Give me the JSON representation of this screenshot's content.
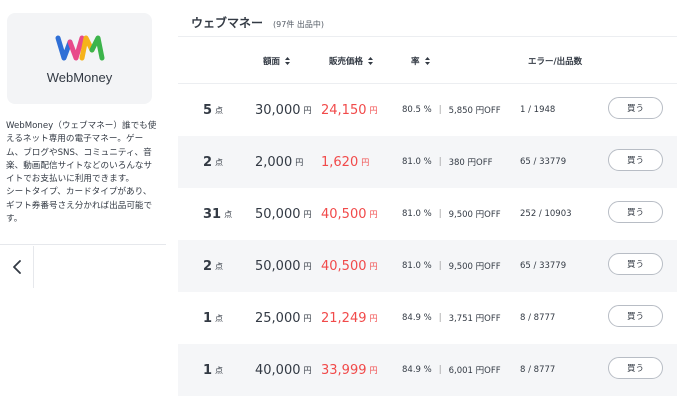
{
  "brand": {
    "logo_text": "WebMoney",
    "description": "WebMoney（ウェブマネー）誰でも使えるネット専用の電子マネー。ゲーム、ブログやSNS、コミュニティ、音楽、動画配信サイトなどのいろんなサイトでお支払いに利用できます。\nシートタイプ、カードタイプがあり、ギフト券番号さえ分かれば出品可能です。"
  },
  "header": {
    "title": "ウェブマネー",
    "count": "(97件 出品中)"
  },
  "columns": {
    "face": "額面",
    "price": "販売価格",
    "rate": "率",
    "errors": "エラー/出品数"
  },
  "units": {
    "qty": "点",
    "yen": "円"
  },
  "buy_label": "買う",
  "rows": [
    {
      "qty": "5",
      "face": "30,000",
      "price": "24,150",
      "rate": "80.5 %",
      "off": "5,850 円OFF",
      "errors": "1 / 1948"
    },
    {
      "qty": "2",
      "face": "2,000",
      "price": "1,620",
      "rate": "81.0 %",
      "off": "380 円OFF",
      "errors": "65 / 33779"
    },
    {
      "qty": "31",
      "face": "50,000",
      "price": "40,500",
      "rate": "81.0 %",
      "off": "9,500 円OFF",
      "errors": "252 / 10903"
    },
    {
      "qty": "2",
      "face": "50,000",
      "price": "40,500",
      "rate": "81.0 %",
      "off": "9,500 円OFF",
      "errors": "65 / 33779"
    },
    {
      "qty": "1",
      "face": "25,000",
      "price": "21,249",
      "rate": "84.9 %",
      "off": "3,751 円OFF",
      "errors": "8 / 8777"
    },
    {
      "qty": "1",
      "face": "40,000",
      "price": "33,999",
      "rate": "84.9 %",
      "off": "6,001 円OFF",
      "errors": "8 / 8777"
    }
  ],
  "colors": {
    "price_red": "#f14a4a",
    "row_alt_bg": "#f5f6f8",
    "text": "#333a44"
  }
}
